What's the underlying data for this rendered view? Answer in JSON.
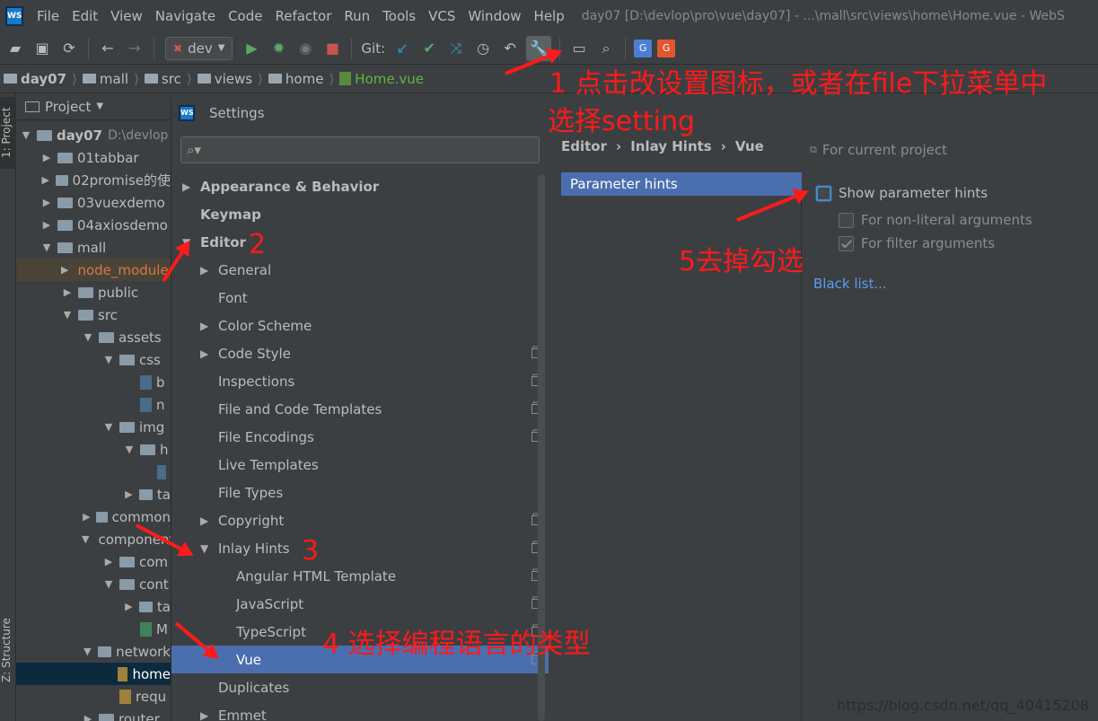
{
  "menubar": {
    "logo": "WS",
    "items": [
      "File",
      "Edit",
      "View",
      "Navigate",
      "Code",
      "Refactor",
      "Run",
      "Tools",
      "VCS",
      "Window",
      "Help"
    ],
    "window_title": "day07 [D:\\devlop\\pro\\vue\\day07] - ...\\mall\\src\\views\\home\\Home.vue - WebS"
  },
  "toolbar": {
    "run_config": "dev",
    "git_label": "Git:"
  },
  "breadcrumb": [
    "day07",
    "mall",
    "src",
    "views",
    "home",
    "Home.vue"
  ],
  "sidestrip": {
    "project_tab": "1: Project",
    "structure_tab": "Z: Structure"
  },
  "project": {
    "header": "Project",
    "rows": [
      {
        "label": "day07",
        "suffix": "D:\\devlop",
        "arrow": "▼",
        "type": "folder",
        "bold": true
      },
      {
        "label": "01tabbar",
        "arrow": "▶",
        "type": "folder"
      },
      {
        "label": "02promise的使",
        "arrow": "▶",
        "type": "folder"
      },
      {
        "label": "03vuexdemo",
        "arrow": "▶",
        "type": "folder"
      },
      {
        "label": "04axiosdemo",
        "arrow": "▶",
        "type": "folder"
      },
      {
        "label": "mall",
        "arrow": "▼",
        "type": "folder"
      },
      {
        "label": "node_modules",
        "arrow": "▶",
        "type": "folder",
        "excluded": true
      },
      {
        "label": "public",
        "arrow": "▶",
        "type": "folder"
      },
      {
        "label": "src",
        "arrow": "▼",
        "type": "folder"
      },
      {
        "label": "assets",
        "arrow": "▼",
        "type": "folder"
      },
      {
        "label": "css",
        "arrow": "▼",
        "type": "folder"
      },
      {
        "label": "b",
        "arrow": "",
        "type": "css"
      },
      {
        "label": "n",
        "arrow": "",
        "type": "css"
      },
      {
        "label": "img",
        "arrow": "▼",
        "type": "folder"
      },
      {
        "label": "h",
        "arrow": "▼",
        "type": "folder"
      },
      {
        "label": "",
        "arrow": "",
        "type": "file"
      },
      {
        "label": "ta",
        "arrow": "▶",
        "type": "folder"
      },
      {
        "label": "common",
        "arrow": "▶",
        "type": "folder"
      },
      {
        "label": "components",
        "arrow": "▼",
        "type": "folder"
      },
      {
        "label": "com",
        "arrow": "▶",
        "type": "folder"
      },
      {
        "label": "cont",
        "arrow": "▼",
        "type": "folder"
      },
      {
        "label": "ta",
        "arrow": "▶",
        "type": "folder"
      },
      {
        "label": "M",
        "arrow": "",
        "type": "vue"
      },
      {
        "label": "network",
        "arrow": "▼",
        "type": "folder"
      },
      {
        "label": "home",
        "arrow": "",
        "type": "js",
        "selected": true
      },
      {
        "label": "requ",
        "arrow": "",
        "type": "js"
      },
      {
        "label": "router",
        "arrow": "▶",
        "type": "folder"
      }
    ]
  },
  "settings": {
    "title": "Settings",
    "search_placeholder": "",
    "nav": [
      {
        "label": "Appearance & Behavior",
        "arrow": "▶",
        "bold": true,
        "indent": 0
      },
      {
        "label": "Keymap",
        "arrow": "",
        "bold": true,
        "indent": 0
      },
      {
        "label": "Editor",
        "arrow": "▼",
        "bold": true,
        "indent": 0
      },
      {
        "label": "General",
        "arrow": "▶",
        "indent": 1
      },
      {
        "label": "Font",
        "arrow": "",
        "indent": 1
      },
      {
        "label": "Color Scheme",
        "arrow": "▶",
        "indent": 1
      },
      {
        "label": "Code Style",
        "arrow": "▶",
        "indent": 1,
        "copy": true
      },
      {
        "label": "Inspections",
        "arrow": "",
        "indent": 1,
        "copy": true
      },
      {
        "label": "File and Code Templates",
        "arrow": "",
        "indent": 1,
        "copy": true
      },
      {
        "label": "File Encodings",
        "arrow": "",
        "indent": 1,
        "copy": true
      },
      {
        "label": "Live Templates",
        "arrow": "",
        "indent": 1
      },
      {
        "label": "File Types",
        "arrow": "",
        "indent": 1
      },
      {
        "label": "Copyright",
        "arrow": "▶",
        "indent": 1,
        "copy": true
      },
      {
        "label": "Inlay Hints",
        "arrow": "▼",
        "indent": 1,
        "copy": true
      },
      {
        "label": "Angular HTML Template",
        "arrow": "",
        "indent": 2,
        "copy": true
      },
      {
        "label": "JavaScript",
        "arrow": "",
        "indent": 2,
        "copy": true
      },
      {
        "label": "TypeScript",
        "arrow": "",
        "indent": 2,
        "copy": true
      },
      {
        "label": "Vue",
        "arrow": "",
        "indent": 2,
        "copy": true,
        "selected": true
      },
      {
        "label": "Duplicates",
        "arrow": "",
        "indent": 1
      },
      {
        "label": "Emmet",
        "arrow": "▶",
        "indent": 1
      }
    ],
    "crumbs": [
      "Editor",
      "›",
      "Inlay Hints",
      "›",
      "Vue"
    ],
    "for_current_project": "For current project",
    "hint_item": "Parameter hints",
    "options": {
      "show_param_hints": "Show parameter hints",
      "non_literal": "For non-literal arguments",
      "filter_args": "For filter arguments",
      "black_list": "Black list..."
    }
  },
  "annotations": {
    "a1_line1": "1 点击改设置图标，或者在file下拉菜单中",
    "a1_line2": "选择setting",
    "a2": "2",
    "a3": "3",
    "a4": "4 选择编程语言的类型",
    "a5": "5去掉勾选"
  },
  "watermark": "https://blog.csdn.net/qq_40415208"
}
